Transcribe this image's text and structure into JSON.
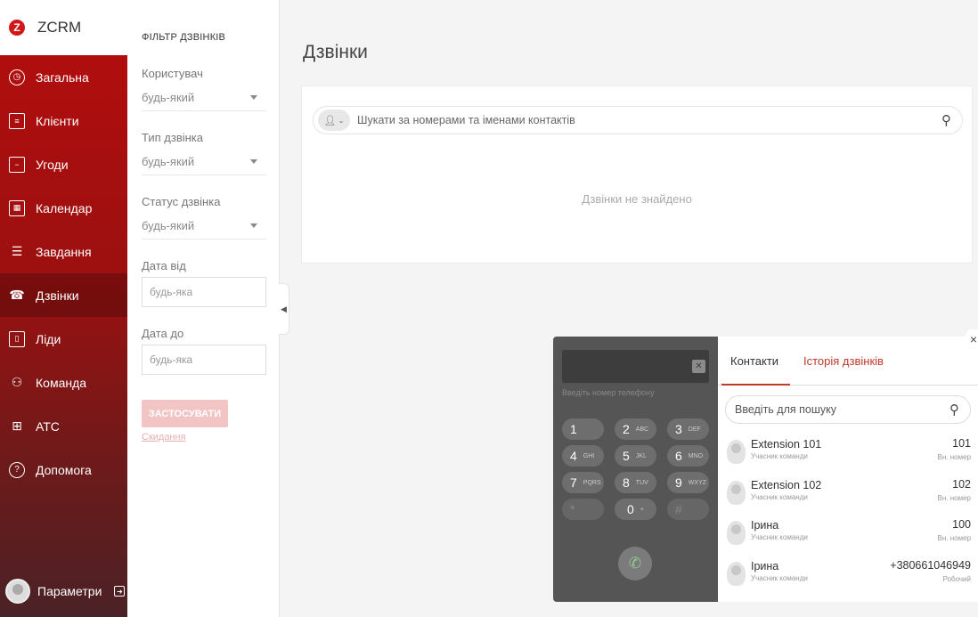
{
  "brand": {
    "logo_letter": "Z",
    "name": "ZCRM"
  },
  "sidebar": {
    "items": [
      {
        "label": "Загальна",
        "icon": "dashboard-icon"
      },
      {
        "label": "Клієнти",
        "icon": "clients-icon"
      },
      {
        "label": "Угоди",
        "icon": "deals-icon"
      },
      {
        "label": "Календар",
        "icon": "calendar-icon"
      },
      {
        "label": "Завдання",
        "icon": "tasks-icon"
      },
      {
        "label": "Дзвінки",
        "icon": "phone-icon",
        "active": true
      },
      {
        "label": "Ліди",
        "icon": "leads-icon"
      },
      {
        "label": "Команда",
        "icon": "team-icon"
      },
      {
        "label": "АТС",
        "icon": "pbx-icon"
      },
      {
        "label": "Допомога",
        "icon": "help-icon"
      }
    ],
    "profile_label": "Параметри"
  },
  "filter": {
    "title": "ФІЛЬТР ДЗВІНКІВ",
    "user_label": "Користувач",
    "user_value": "будь-який",
    "type_label": "Тип дзвінка",
    "type_value": "будь-який",
    "status_label": "Статус дзвінка",
    "status_value": "будь-який",
    "date_from_label": "Дата від",
    "date_from_placeholder": "будь-яка",
    "date_to_label": "Дата до",
    "date_to_placeholder": "будь-яка",
    "apply_label": "ЗАСТОСУВАТИ",
    "reset_label": "Скидання"
  },
  "main": {
    "title": "Дзвінки",
    "search_placeholder": "Шукати за номерами та іменами контактів",
    "empty_text": "Дзвінки не знайдено"
  },
  "dialer": {
    "phone_placeholder": "Введіть номер телефону",
    "keys": [
      {
        "digit": "1",
        "letters": ""
      },
      {
        "digit": "2",
        "letters": "ABC"
      },
      {
        "digit": "3",
        "letters": "DEF"
      },
      {
        "digit": "4",
        "letters": "GHI"
      },
      {
        "digit": "5",
        "letters": "JKL"
      },
      {
        "digit": "6",
        "letters": "MNO"
      },
      {
        "digit": "7",
        "letters": "PQRS"
      },
      {
        "digit": "8",
        "letters": "TUV"
      },
      {
        "digit": "9",
        "letters": "WXYZ"
      },
      {
        "digit": "*",
        "letters": ""
      },
      {
        "digit": "0",
        "letters": "+"
      },
      {
        "digit": "#",
        "letters": ""
      }
    ]
  },
  "contacts": {
    "tab_contacts": "Контакти",
    "tab_history": "Історія дзвінків",
    "search_placeholder": "Введіть для пошуку",
    "list": [
      {
        "name": "Extension 101",
        "role": "Учасник команди",
        "number": "101",
        "type": "Вн. номер"
      },
      {
        "name": "Extension 102",
        "role": "Учасник команди",
        "number": "102",
        "type": "Вн. номер"
      },
      {
        "name": "Ірина",
        "role": "Учасник команди",
        "number": "100",
        "type": "Вн. номер"
      },
      {
        "name": "Ірина",
        "role": "Учасник команди",
        "number": "+380661046949",
        "type": "Робочий"
      }
    ]
  },
  "colors": {
    "accent": "#b50d0d",
    "dialer_bg": "#555555",
    "tab_active": "#c0392b"
  }
}
